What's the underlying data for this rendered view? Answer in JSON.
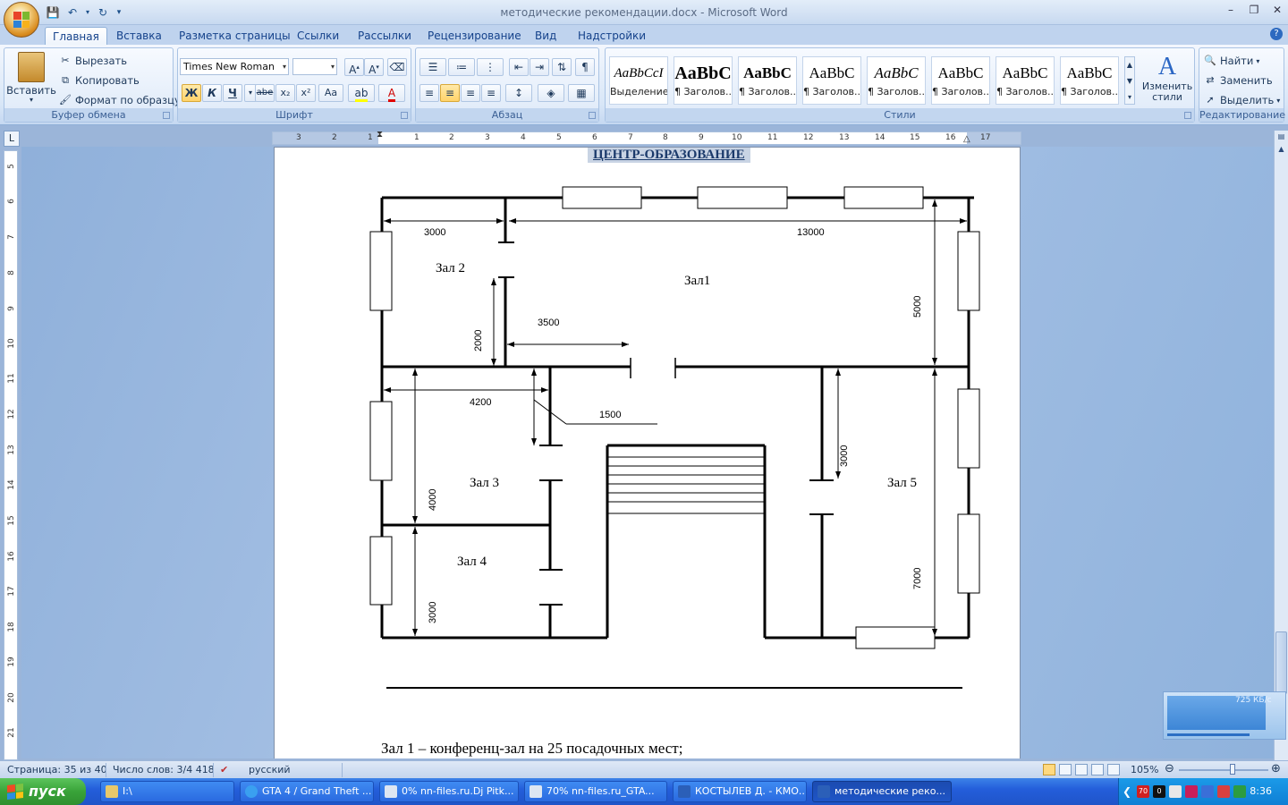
{
  "window": {
    "title": "методические рекомендации.docx - Microsoft Word"
  },
  "ribbon": {
    "tabs": [
      "Главная",
      "Вставка",
      "Разметка страницы",
      "Ссылки",
      "Рассылки",
      "Рецензирование",
      "Вид",
      "Надстройки"
    ],
    "active_tab": "Главная",
    "clipboard": {
      "paste": "Вставить",
      "cut": "Вырезать",
      "copy": "Копировать",
      "format_painter": "Формат по образцу",
      "label": "Буфер обмена"
    },
    "font": {
      "name": "Times New Roman",
      "size": "",
      "label": "Шрифт",
      "bold": "Ж",
      "italic": "К",
      "underline": "Ч",
      "strike": "abe",
      "subscript": "x₂",
      "superscript": "x²",
      "case": "Aa"
    },
    "paragraph": {
      "label": "Абзац"
    },
    "styles": {
      "label": "Стили",
      "items": [
        {
          "sample": "AaBbCcI",
          "name": "Выделение"
        },
        {
          "sample": "AaBbC",
          "name": "¶ Заголов..."
        },
        {
          "sample": "AaBbC",
          "name": "¶ Заголов..."
        },
        {
          "sample": "AaBbC",
          "name": "¶ Заголов..."
        },
        {
          "sample": "AaBbC",
          "name": "¶ Заголов..."
        },
        {
          "sample": "AaBbC",
          "name": "¶ Заголов..."
        },
        {
          "sample": "AaBbC",
          "name": "¶ Заголов..."
        },
        {
          "sample": "AaBbC",
          "name": "¶ Заголов..."
        }
      ],
      "change_styles": "Изменить стили"
    },
    "editing": {
      "label": "Редактирование",
      "find": "Найти",
      "replace": "Заменить",
      "select": "Выделить"
    }
  },
  "ruler": {
    "numbers": [
      "3",
      "2",
      "1",
      "1",
      "2",
      "3",
      "4",
      "5",
      "6",
      "7",
      "8",
      "9",
      "10",
      "11",
      "12",
      "13",
      "14",
      "15",
      "16",
      "17"
    ],
    "vertical_numbers": [
      "5",
      "6",
      "7",
      "8",
      "9",
      "10",
      "11",
      "12",
      "13",
      "14",
      "15",
      "16",
      "17",
      "18",
      "19",
      "20",
      "21"
    ]
  },
  "document": {
    "heading": "ЦЕНТР-ОБРАЗОВАНИЕ",
    "plan": {
      "rooms": [
        "Зал 2",
        "Зал1",
        "Зал 3",
        "Зал 4",
        "Зал 5"
      ],
      "dimensions": [
        "3000",
        "13000",
        "5000",
        "2000",
        "3500",
        "4200",
        "1500",
        "3000",
        "4000",
        "3000",
        "7000"
      ]
    },
    "paragraph": "Зал 1 – конференц-зал на 25 посадочных мест;"
  },
  "statusbar": {
    "page": "Страница: 35 из 40",
    "words": "Число слов: 3/4 418",
    "language": "русский",
    "zoom": "105%",
    "zoom_fraction": 0.6
  },
  "network_widget": {
    "rate": "725 КБ/с"
  },
  "taskbar": {
    "start": "пуск",
    "items": [
      {
        "label": "I:\\"
      },
      {
        "label": "GTA 4 / Grand Theft ..."
      },
      {
        "label": "0% nn-files.ru.Dj Pitk..."
      },
      {
        "label": "70% nn-files.ru_GTA..."
      },
      {
        "label": "КОСТЫЛЕВ Д. - КМО..."
      },
      {
        "label": "методические реко..."
      }
    ],
    "tray_badge": "70",
    "tray_badge2": "0",
    "clock": "8:36"
  }
}
